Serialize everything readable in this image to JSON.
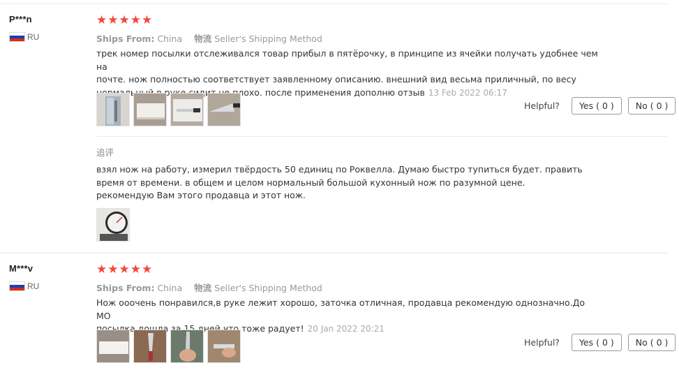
{
  "reviews": [
    {
      "user": "P***n",
      "country": "RU",
      "rating": 5,
      "ships_label": "Ships From:",
      "ships_from": "China",
      "shipping_label": "物流",
      "shipping_method": "Seller's Shipping Method",
      "text_lines": [
        "трек номер посылки отслеживался товар прибыл в пятёрочку, в принципе из ячейки получать удобнее чем на",
        "почте. нож полностью соответствует заявленному описанию. внешний вид весьма приличный, по весу",
        "нормальный в руке сидит не плохо. после применения дополню отзыв"
      ],
      "date": "13 Feb 2022 06:17",
      "photos": [
        "knife-in-box-photo",
        "white-box-photo",
        "open-box-photo",
        "knife-blade-photo"
      ],
      "helpful_label": "Helpful?",
      "yes_label": "Yes ( 0 )",
      "no_label": "No ( 0 )",
      "additional": {
        "title": "追评",
        "text_lines": [
          "взял нож на работу, измерил твёрдость 50 единиц по Роквелла. Думаю быстро тупиться будет. править",
          "время от времени. в общем и целом нормальный большой кухонный нож по разумной цене.",
          "рекомендую Вам этого продавца и этот нож."
        ],
        "photos": [
          "hardness-tester-photo"
        ]
      }
    },
    {
      "user": "M***v",
      "country": "RU",
      "rating": 5,
      "ships_label": "Ships From:",
      "ships_from": "China",
      "shipping_label": "物流",
      "shipping_method": "Seller's Shipping Method",
      "text_lines": [
        "Нож ооочень понравился,в руке лежит хорошо, заточка отличная, продавца рекомендую однозначно.До МО",
        "посылка дошла за 15 дней,что тоже радует!"
      ],
      "date": "20 Jan 2022 20:21",
      "photos": [
        "white-package-photo",
        "knife-on-table-photo",
        "knife-in-hand-photo",
        "knife-closeup-photo"
      ],
      "helpful_label": "Helpful?",
      "yes_label": "Yes ( 0 )",
      "no_label": "No ( 0 )"
    }
  ],
  "colors": {
    "star": "#f5463d",
    "muted": "#999999",
    "flag_blue": "#1a3fb0",
    "flag_red": "#d52b1e"
  }
}
